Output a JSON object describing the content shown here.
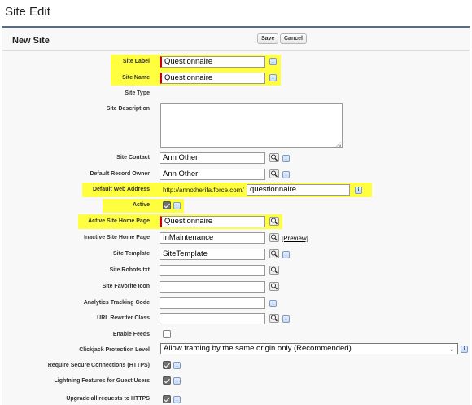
{
  "page_title": "Site Edit",
  "panel": {
    "title": "New Site",
    "save_label": "Save",
    "cancel_label": "Cancel"
  },
  "info_glyph": "i",
  "fields": {
    "site_label": {
      "label": "Site Label",
      "value": "Questionnaire"
    },
    "site_name": {
      "label": "Site Name",
      "value": "Questionnaire"
    },
    "site_type": {
      "label": "Site Type"
    },
    "site_description": {
      "label": "Site Description",
      "value": ""
    },
    "site_contact": {
      "label": "Site Contact",
      "value": "Ann Other"
    },
    "default_record_owner": {
      "label": "Default Record Owner",
      "value": "Ann Other"
    },
    "default_web_address": {
      "label": "Default Web Address",
      "prefix": "http://annotherifa.force.com/",
      "value": "questionnaire"
    },
    "active": {
      "label": "Active",
      "checked": true
    },
    "active_home_page": {
      "label": "Active Site Home Page",
      "value": "Questionnaire"
    },
    "inactive_home_page": {
      "label": "Inactive Site Home Page",
      "value": "InMaintenance",
      "preview_link": "[Preview]"
    },
    "site_template": {
      "label": "Site Template",
      "value": "SiteTemplate"
    },
    "site_robots": {
      "label": "Site Robots.txt",
      "value": ""
    },
    "site_favorite_icon": {
      "label": "Site Favorite Icon",
      "value": ""
    },
    "analytics_tracking_code": {
      "label": "Analytics Tracking Code",
      "value": ""
    },
    "url_rewriter_class": {
      "label": "URL Rewriter Class",
      "value": ""
    },
    "enable_feeds": {
      "label": "Enable Feeds",
      "checked": false
    },
    "clickjack_protection": {
      "label": "Clickjack Protection Level",
      "value": "Allow framing by the same origin only (Recommended)"
    },
    "require_https": {
      "label": "Require Secure Connections (HTTPS)",
      "checked": true
    },
    "lightning_guest": {
      "label": "Lightning Features for Guest Users",
      "checked": true
    },
    "upgrade_https": {
      "label": "Upgrade all requests to HTTPS",
      "checked": true
    }
  },
  "colors": {
    "highlight": "#ffff40",
    "required": "#cc0000",
    "panel_border": "#5a6c85"
  },
  "icons": {
    "lookup": "magnifier-lookup-icon",
    "info": "info-icon"
  }
}
